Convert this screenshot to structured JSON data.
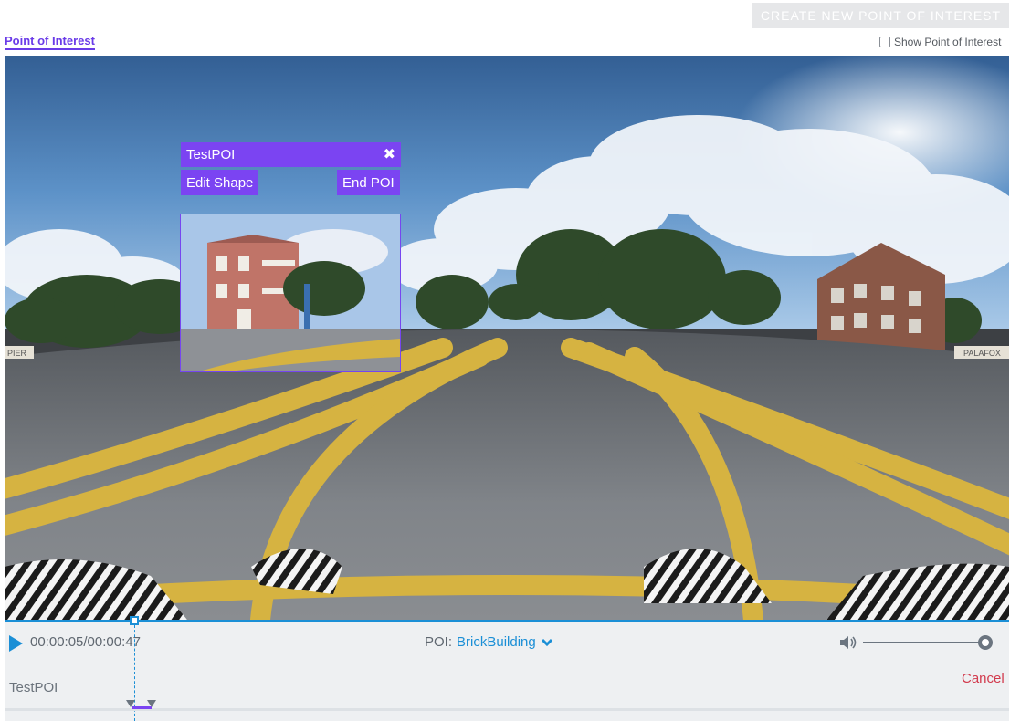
{
  "toolbar": {
    "create_label": "CREATE NEW POINT OF INTEREST"
  },
  "header": {
    "poi_link": "Point of Interest",
    "show_poi_label": "Show Point of Interest",
    "show_poi_checked": false
  },
  "poi_overlay": {
    "title": "TestPOI",
    "edit_label": "Edit Shape",
    "end_label": "End POI"
  },
  "video_scene": {
    "sign_left": "PIER",
    "sign_right": "PALAFOX"
  },
  "controls": {
    "time": "00:00:05/00:00:47",
    "poi_label": "POI:",
    "poi_value": "BrickBuilding",
    "cancel_label": "Cancel",
    "track_label": "TestPOI"
  },
  "colors": {
    "accent": "#7b44f2",
    "primary": "#1b8fd6",
    "danger": "#d23a4d"
  },
  "icons": {
    "play": "play-icon",
    "close": "close-icon",
    "chevron": "chevron-down-icon",
    "volume": "volume-icon"
  }
}
